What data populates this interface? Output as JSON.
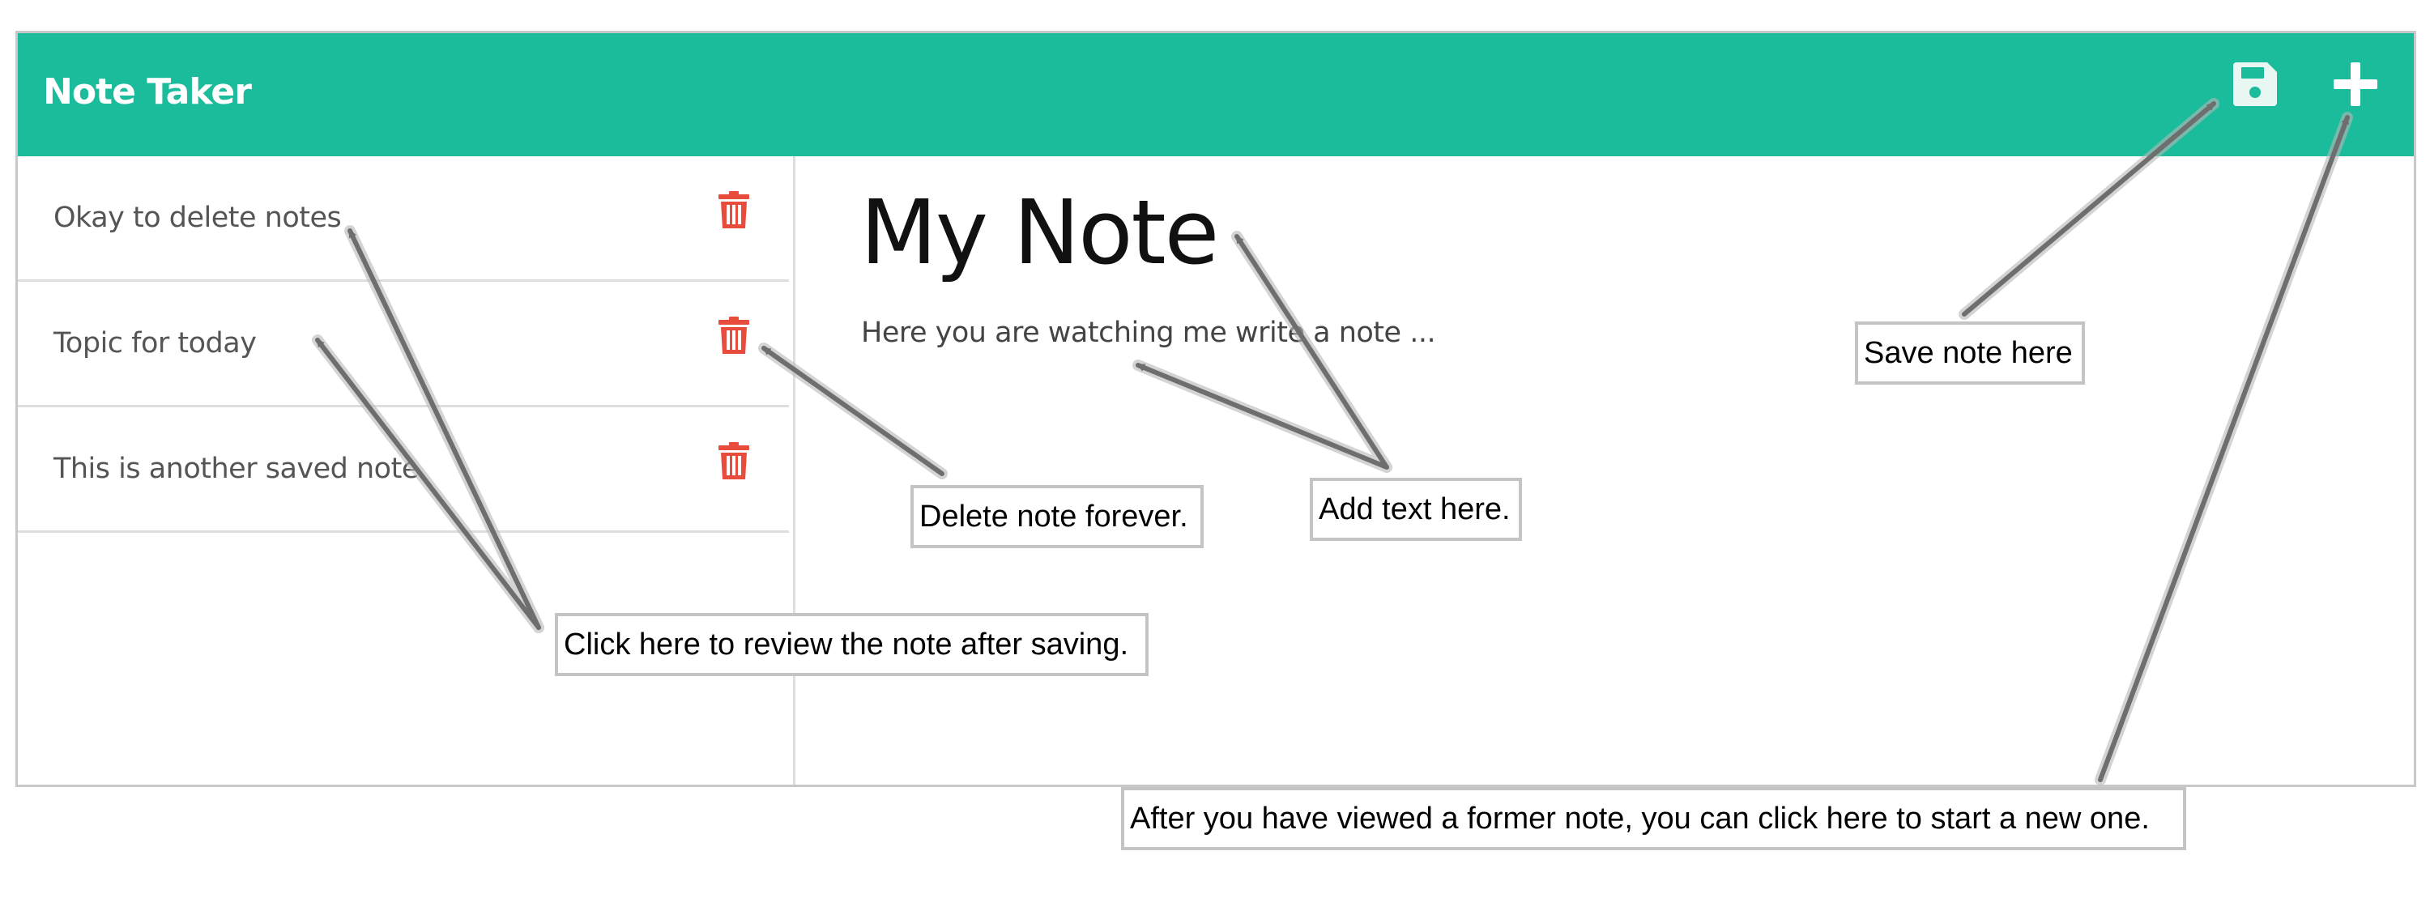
{
  "app": {
    "title": "Note Taker",
    "accent_color": "#1abc9c",
    "delete_color": "#e74c3c"
  },
  "navbar": {
    "save_icon": "floppy-disk-icon",
    "new_icon": "plus-icon"
  },
  "notes": [
    {
      "title": "Okay to delete notes",
      "icon": "trash-icon"
    },
    {
      "title": "Topic for today",
      "icon": "trash-icon"
    },
    {
      "title": "This is another saved note",
      "icon": "trash-icon"
    }
  ],
  "editor": {
    "title": "My Note",
    "text": "Here you are watching me write a note ..."
  },
  "callouts": {
    "review": "Click here to review the note after saving.",
    "delete": "Delete note forever.",
    "add_text": "Add text here.",
    "save": "Save note here",
    "new_note": "After you have viewed a former note, you can click here to start a new one."
  }
}
